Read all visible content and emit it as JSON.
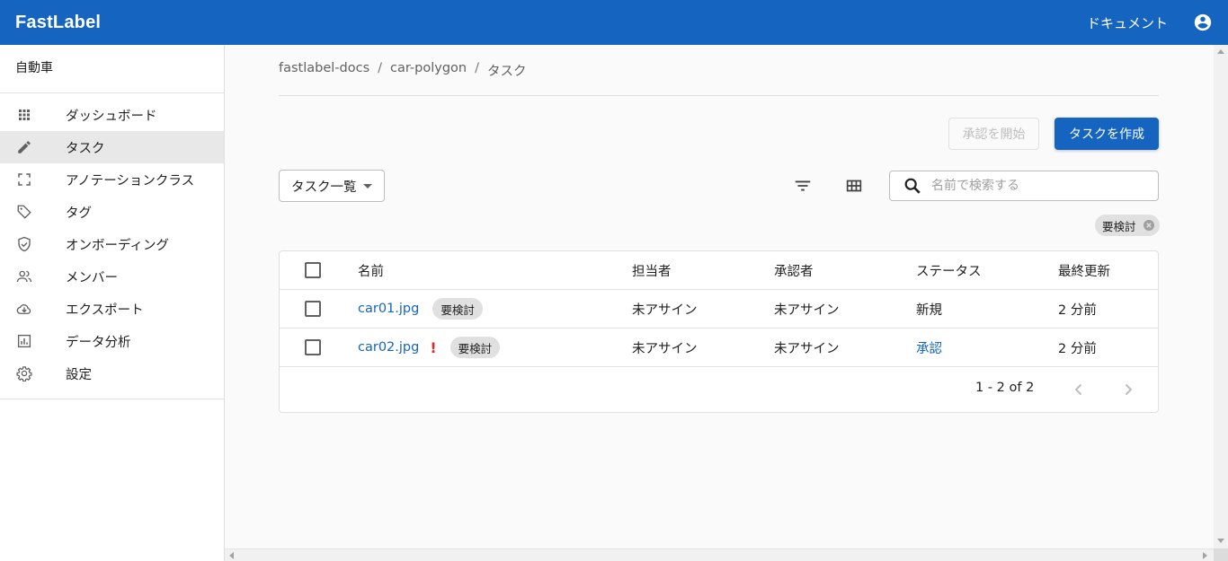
{
  "header": {
    "brand": "FastLabel",
    "docs_link": "ドキュメント",
    "account_icon": "account-circle-icon"
  },
  "sidebar": {
    "project": "自動車",
    "items": [
      {
        "label": "ダッシュボード",
        "icon": "grid-dots-icon",
        "active": false
      },
      {
        "label": "タスク",
        "icon": "pencil-icon",
        "active": true
      },
      {
        "label": "アノテーションクラス",
        "icon": "crop-frame-icon",
        "active": false
      },
      {
        "label": "タグ",
        "icon": "tag-icon",
        "active": false
      },
      {
        "label": "オンボーディング",
        "icon": "shield-check-icon",
        "active": false
      },
      {
        "label": "メンバー",
        "icon": "people-icon",
        "active": false
      },
      {
        "label": "エクスポート",
        "icon": "cloud-download-icon",
        "active": false
      },
      {
        "label": "データ分析",
        "icon": "analytics-icon",
        "active": false
      },
      {
        "label": "設定",
        "icon": "gear-icon",
        "active": false
      }
    ]
  },
  "breadcrumb": [
    "fastlabel-docs",
    "car-polygon",
    "タスク"
  ],
  "actions": {
    "approve_label": "承認を開始",
    "create_label": "タスクを作成"
  },
  "toolbar": {
    "view_select": "タスク一覧",
    "search_placeholder": "名前で検索する",
    "filter_chip": "要検討"
  },
  "table": {
    "headers": {
      "name": "名前",
      "assignee": "担当者",
      "approver": "承認者",
      "status": "ステータス",
      "updated": "最終更新"
    },
    "rows": [
      {
        "name": "car01.jpg",
        "warning": false,
        "tag": "要検討",
        "assignee": "未アサイン",
        "approver": "未アサイン",
        "status": "新規",
        "status_link": false,
        "updated": "2 分前"
      },
      {
        "name": "car02.jpg",
        "warning": true,
        "warning_mark": "!",
        "tag": "要検討",
        "assignee": "未アサイン",
        "approver": "未アサイン",
        "status": "承認",
        "status_link": true,
        "updated": "2 分前"
      }
    ],
    "pagination": "1 - 2 of 2"
  },
  "colors": {
    "primary": "#1565c0",
    "warning": "#d32f2f"
  }
}
